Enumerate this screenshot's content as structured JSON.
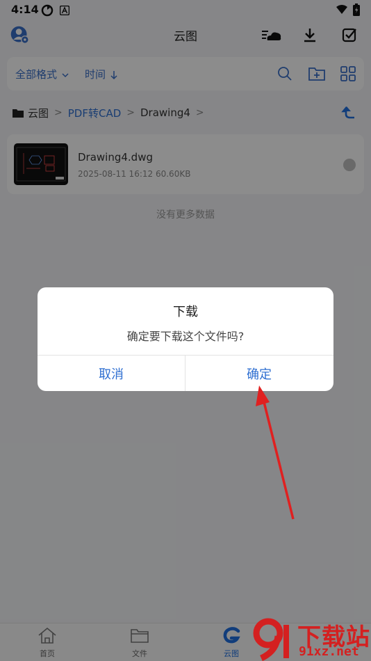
{
  "status_bar": {
    "time": "4:14"
  },
  "header": {
    "title": "云图"
  },
  "toolbar": {
    "format_filter": "全部格式",
    "time_sort": "时间"
  },
  "breadcrumb": {
    "items": [
      "云图",
      "PDF转CAD",
      "Drawing4"
    ]
  },
  "file": {
    "name": "Drawing4.dwg",
    "date": "2025-08-11 16:12",
    "size": "60.60KB"
  },
  "list": {
    "no_more": "没有更多数据"
  },
  "bottom_nav": {
    "items": [
      {
        "label": "首页"
      },
      {
        "label": "文件"
      },
      {
        "label": "云图"
      }
    ]
  },
  "dialog": {
    "title": "下载",
    "message": "确定要下载这个文件吗?",
    "cancel": "取消",
    "confirm": "确定"
  },
  "watermark": {
    "brand": "下载站",
    "domain": "91xz.net"
  },
  "colors": {
    "accent": "#2f6fd1",
    "arrow": "#e02020",
    "watermark": "#d42020"
  }
}
